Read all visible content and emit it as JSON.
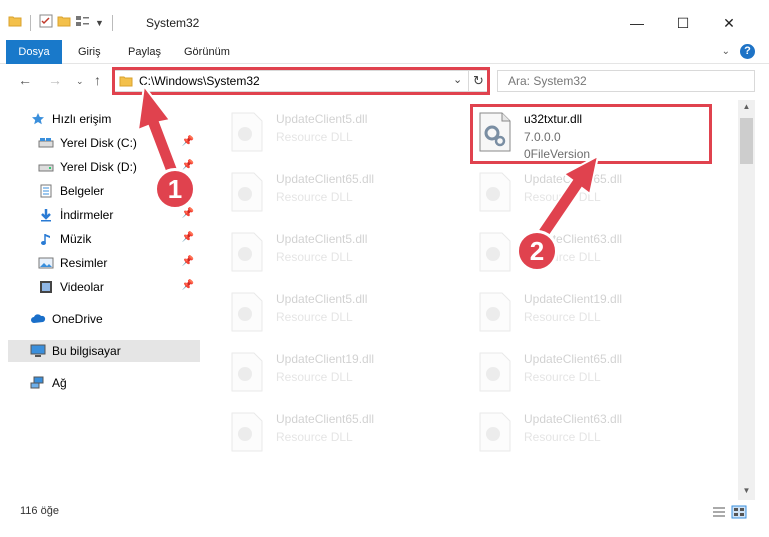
{
  "window": {
    "title": "System32",
    "minimize": "—",
    "maximize": "☐",
    "close": "✕"
  },
  "ribbon": {
    "tabs": [
      "Dosya",
      "Giriş",
      "Paylaş",
      "Görünüm"
    ]
  },
  "navigation": {
    "address": "C:\\Windows\\System32",
    "search_placeholder": "Ara: System32"
  },
  "sidebar": {
    "items": [
      {
        "label": "Hızlı erişim",
        "icon": "star-icon",
        "pinned": false
      },
      {
        "label": "Yerel Disk (C:)",
        "icon": "drive-icon",
        "pinned": true
      },
      {
        "label": "Yerel Disk (D:)",
        "icon": "drive-icon",
        "pinned": true
      },
      {
        "label": "Belgeler",
        "icon": "documents-icon",
        "pinned": true
      },
      {
        "label": "İndirmeler",
        "icon": "download-icon",
        "pinned": true
      },
      {
        "label": "Müzik",
        "icon": "music-icon",
        "pinned": true
      },
      {
        "label": "Resimler",
        "icon": "pictures-icon",
        "pinned": true
      },
      {
        "label": "Videolar",
        "icon": "video-icon",
        "pinned": true
      },
      {
        "label": "OneDrive",
        "icon": "cloud-icon",
        "pinned": false
      },
      {
        "label": "Bu bilgisayar",
        "icon": "computer-icon",
        "pinned": false
      },
      {
        "label": "Ağ",
        "icon": "network-icon",
        "pinned": false
      }
    ]
  },
  "files": {
    "highlighted": {
      "name": "u32txtur.dll",
      "version": "7.0.0.0",
      "description": "0FileVersion"
    },
    "background": [
      {
        "name": "UpdateClient5.dll",
        "type": "Resource DLL"
      },
      {
        "name": "UpdateClient65.dll",
        "type": "Resource DLL"
      },
      {
        "name": "UpdateClient65.dll",
        "type": "Resource DLL"
      },
      {
        "name": "UpdateClient5.dll",
        "type": "Resource DLL"
      },
      {
        "name": "UpdateClient63.dll",
        "type": "Resource DLL"
      },
      {
        "name": "UpdateClient5.dll",
        "type": "Resource DLL"
      },
      {
        "name": "UpdateClient19.dll",
        "type": "Resource DLL"
      },
      {
        "name": "UpdateClient19.dll",
        "type": "Resource DLL"
      },
      {
        "name": "UpdateClient65.dll",
        "type": "Resource DLL"
      },
      {
        "name": "UpdateClient65.dll",
        "type": "Resource DLL"
      },
      {
        "name": "UpdateClient63.dll",
        "type": "Resource DLL"
      }
    ]
  },
  "status": {
    "item_count": "116 öğe"
  },
  "annotations": {
    "step1": "1",
    "step2": "2",
    "color": "#e0424e"
  }
}
